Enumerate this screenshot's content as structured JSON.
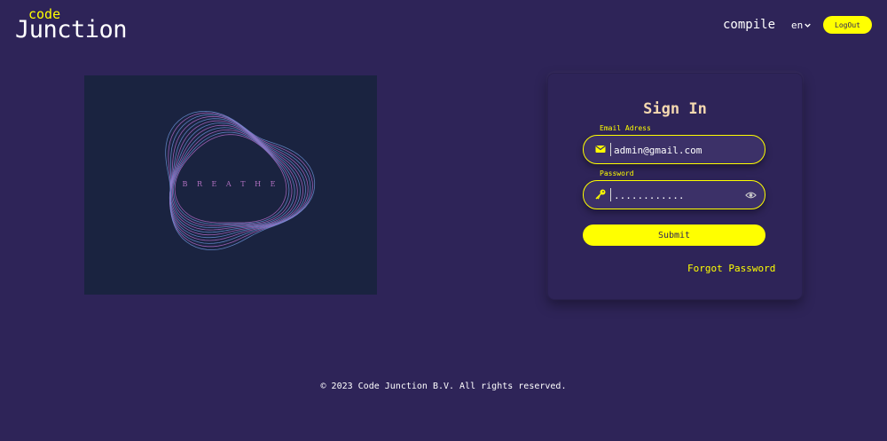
{
  "header": {
    "logo_top": "code",
    "logo_main": "Junction",
    "nav_compile": "compile",
    "lang": "en",
    "logout_label": "LogOut"
  },
  "art": {
    "text": "B R E A T H E",
    "colors": {
      "background": "#1a2340",
      "ring_outer": "#6a8fd4",
      "ring_inner": "#b06ac4"
    }
  },
  "signin": {
    "title": "Sign In",
    "email_label": "Email Adress",
    "email_value": "admin@gmail.com",
    "email_icon": "envelope-icon",
    "password_label": "Password",
    "password_value": "............",
    "password_icon": "key-icon",
    "toggle_icon": "eye-icon",
    "submit_label": "Submit",
    "forgot_label": "Forgot Password"
  },
  "footer": {
    "copyright": "© 2023 Code Junction B.V. All rights reserved."
  },
  "colors": {
    "background": "#2e2458",
    "accent": "#ffff00",
    "title": "#f5d9b0"
  }
}
